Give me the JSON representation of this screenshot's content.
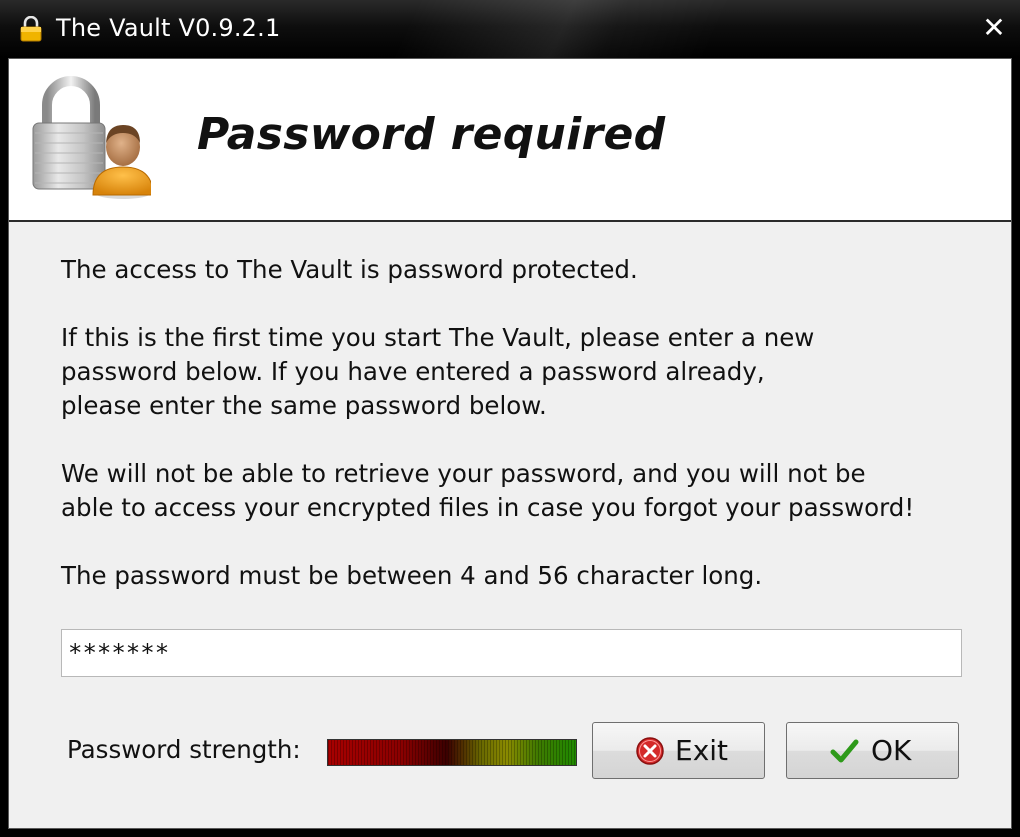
{
  "window": {
    "title": "The Vault V0.9.2.1",
    "title_icon": "padlock-icon",
    "close_glyph": "✕"
  },
  "header": {
    "title": "Password required",
    "icon": "padlock-user-icon"
  },
  "body": {
    "line1": "The access to The Vault is password protected.",
    "para2_line1": "If this is the first time you start The Vault, please enter a new",
    "para2_line2": "password below. If you have entered a password already,",
    "para2_line3": "please enter the same password below.",
    "para3_line1": "We will not be able to retrieve your password, and you will not be",
    "para3_line2": "able to access your encrypted files in case you forgot your password!",
    "para4": "The password must be between 4 and 56 character long."
  },
  "password_input": {
    "value": "*******"
  },
  "strength": {
    "label": "Password strength:",
    "level": 1.0
  },
  "buttons": {
    "exit_label": "Exit",
    "exit_icon": "cancel-x-icon",
    "ok_label": "OK",
    "ok_icon": "checkmark-icon"
  },
  "colors": {
    "client_bg": "#f0f0f0",
    "exit_icon_red": "#d42a2a",
    "ok_icon_green": "#2e9a1a"
  }
}
